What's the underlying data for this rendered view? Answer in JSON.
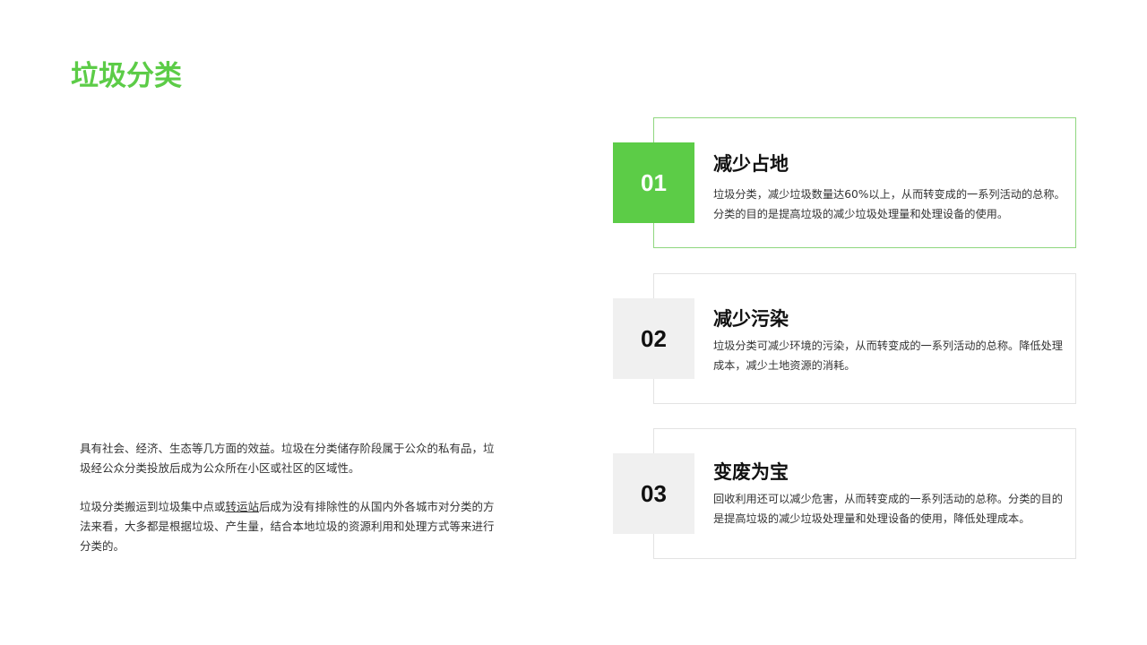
{
  "colors": {
    "accent": "#5ccc47",
    "card_border_active": "#8fd77f",
    "card_border": "#e3e3e3",
    "number_box_inactive": "#f0f0f0"
  },
  "page": {
    "title": "垃圾分类"
  },
  "intro": {
    "paragraph_1": "具有社会、经济、生态等几方面的效益。垃圾在分类储存阶段属于公众的私有品，垃圾经公众分类投放后成为公众所在小区或社区的区域性。",
    "paragraph_2_before": "垃圾分类搬运到垃圾集中点或",
    "paragraph_2_term": "转运站",
    "paragraph_2_after": "后成为没有排除性的从国内外各城市对分类的方法来看，大多都是根据垃圾、产生量，结合本地垃圾的资源利用和处理方式等来进行分类的。"
  },
  "cards": [
    {
      "number": "01",
      "title": "减少占地",
      "description": "垃圾分类，减少垃圾数量达60%以上，从而转变成的一系列活动的总称。分类的目的是提高垃圾的减少垃圾处理量和处理设备的使用。",
      "active": true
    },
    {
      "number": "02",
      "title": "减少污染",
      "description": "垃圾分类可减少环境的污染，从而转变成的一系列活动的总称。降低处理成本，减少土地资源的消耗。",
      "active": false
    },
    {
      "number": "03",
      "title": "变废为宝",
      "description": "回收利用还可以减少危害，从而转变成的一系列活动的总称。分类的目的是提高垃圾的减少垃圾处理量和处理设备的使用，降低处理成本。",
      "active": false
    }
  ]
}
